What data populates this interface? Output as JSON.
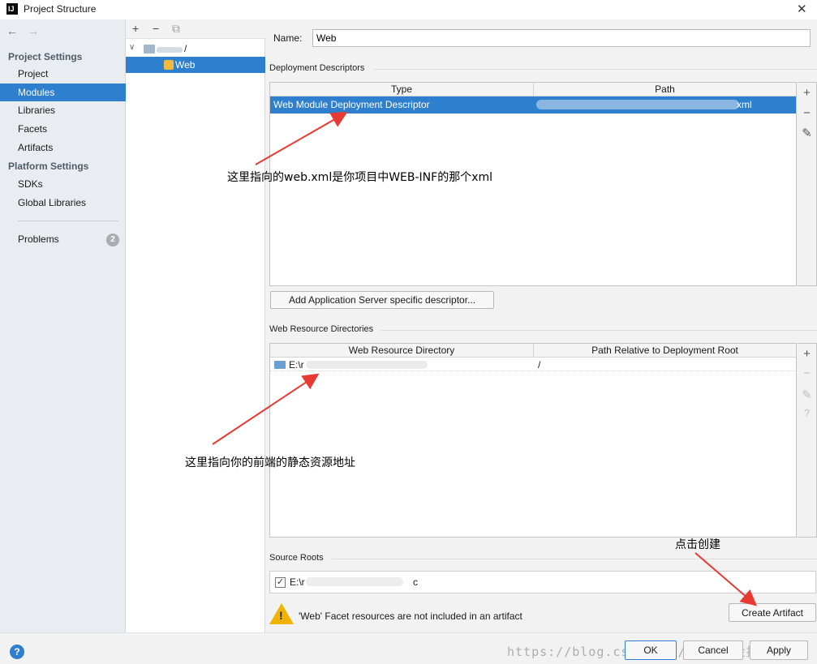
{
  "window": {
    "title": "Project Structure",
    "app_logo": "IJ",
    "close_glyph": "✕"
  },
  "nav": {
    "back_glyph": "←",
    "forward_glyph": "→",
    "project_settings_heading": "Project Settings",
    "project_settings_items": [
      "Project",
      "Modules",
      "Libraries",
      "Facets",
      "Artifacts"
    ],
    "selected_item": "Modules",
    "platform_settings_heading": "Platform Settings",
    "platform_settings_items": [
      "SDKs",
      "Global Libraries"
    ],
    "problems_label": "Problems",
    "problems_count": "2"
  },
  "tree": {
    "add_glyph": "+",
    "remove_glyph": "−",
    "copy_glyph": "⧉",
    "expand_glyph": "∨",
    "root_suffix": "/",
    "child_label": "Web"
  },
  "facet": {
    "name_label": "Name:",
    "name_value": "Web",
    "deployment_descriptors": {
      "section_label": "Deployment Descriptors",
      "columns": [
        "Type",
        "Path"
      ],
      "rows": [
        {
          "type": "Web Module Deployment Descriptor",
          "path_suffix": "xml"
        }
      ],
      "add_server_descriptor_label": "Add Application Server specific descriptor..."
    },
    "web_resource_directories": {
      "section_label": "Web Resource Directories",
      "columns": [
        "Web Resource Directory",
        "Path Relative to Deployment Root"
      ],
      "rows": [
        {
          "directory_prefix": "E:\\r",
          "relative_path": "/"
        }
      ]
    },
    "source_roots": {
      "section_label": "Source Roots",
      "checked_glyph": "✓",
      "path_prefix": "E:\\r",
      "path_suffix": "c"
    },
    "warning_text": "'Web' Facet resources are not included in an artifact",
    "warning_glyph": "!",
    "create_artifact_label": "Create Artifact"
  },
  "side_tools": {
    "add": "+",
    "remove": "−",
    "edit": "✎",
    "help": "?"
  },
  "footer": {
    "help_glyph": "?",
    "ok_label": "OK",
    "cancel_label": "Cancel",
    "apply_label": "Apply",
    "watermark": "https://blog.csdn.net/@稀土掘金技术社区"
  },
  "annotations": {
    "descriptor_note": "这里指向的web.xml是你项目中WEB-INF的那个xml",
    "resource_note": "这里指向你的前端的静态资源地址",
    "artifact_note": "点击创建",
    "color": "#e83a32"
  },
  "colors": {
    "selection": "#2e7fcd",
    "warning": "#f0b400",
    "folder": "#6a9fd4",
    "facet_icon": "#f2b941"
  }
}
